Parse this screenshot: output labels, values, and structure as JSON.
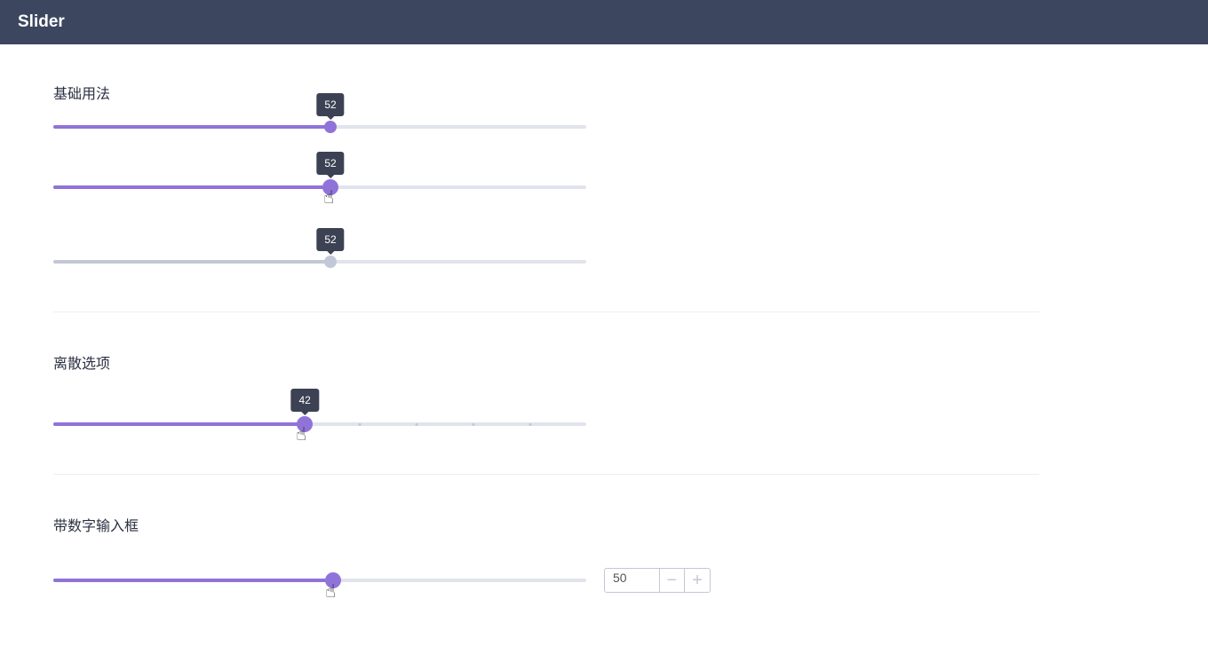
{
  "header": {
    "title": "Slider"
  },
  "sections": [
    {
      "title": "基础用法",
      "sliders": [
        {
          "value": 52,
          "tooltip": "52",
          "state": "normal"
        },
        {
          "value": 52,
          "tooltip": "52",
          "state": "hover"
        },
        {
          "value": 52,
          "tooltip": "52",
          "state": "disabled"
        }
      ]
    },
    {
      "title": "离散选项",
      "sliders": [
        {
          "value": 42,
          "tooltip": "42",
          "state": "hover"
        }
      ]
    },
    {
      "title": "带数字输入框",
      "sliders": [
        {
          "value": 50,
          "state": "hover"
        }
      ],
      "input": {
        "value": "50",
        "minus": "−",
        "plus": "+"
      }
    }
  ],
  "colors": {
    "accent": "#9073d8",
    "header": "#3c465f",
    "disabled": "#c3c8d6"
  }
}
